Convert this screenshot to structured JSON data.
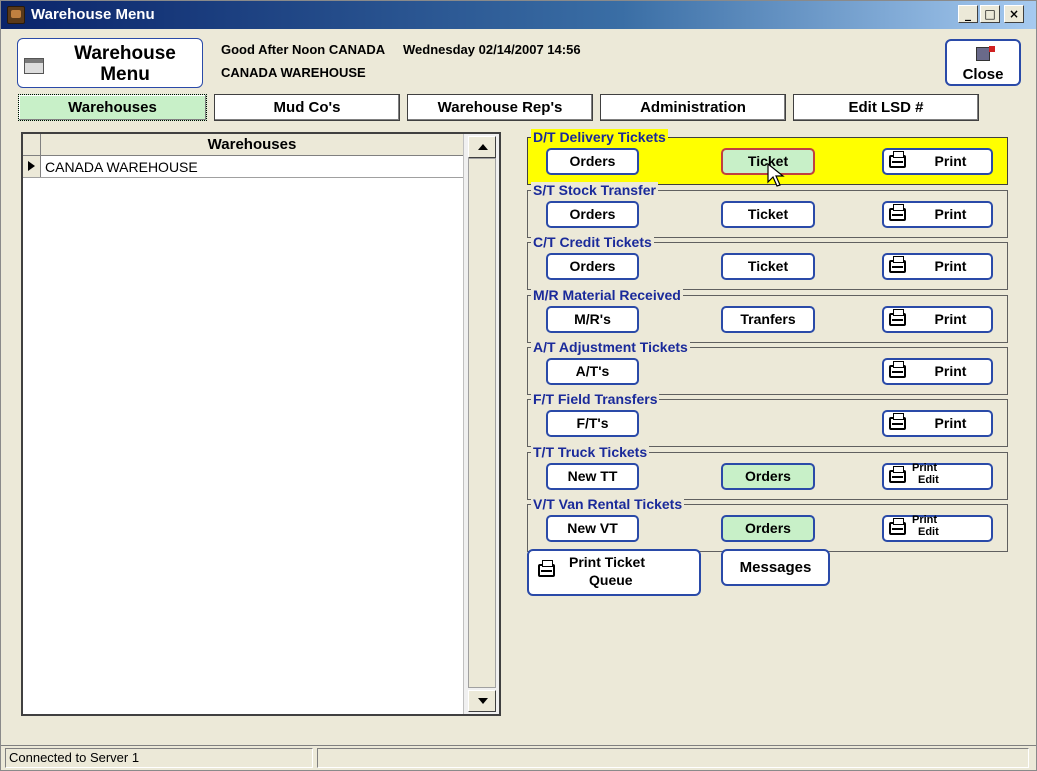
{
  "window": {
    "title": "Warehouse Menu",
    "minimize": "_",
    "maximize": "□",
    "close": "×"
  },
  "header": {
    "box_line1": "Warehouse",
    "box_line2": "Menu",
    "greeting": "Good After Noon CANADA",
    "warehouse": "CANADA WAREHOUSE",
    "datetime": "Wednesday 02/14/2007 14:56",
    "close_label": "Close"
  },
  "tabs": [
    {
      "label": "Warehouses",
      "active": true
    },
    {
      "label": "Mud Co's"
    },
    {
      "label": "Warehouse Rep's"
    },
    {
      "label": "Administration"
    },
    {
      "label": "Edit LSD #"
    }
  ],
  "grid": {
    "column": "Warehouses",
    "rows": [
      "CANADA WAREHOUSE"
    ]
  },
  "groups": [
    {
      "title": "D/T Delivery Tickets",
      "buttons": [
        "Orders",
        "Ticket",
        "Print"
      ]
    },
    {
      "title": "S/T Stock Transfer",
      "buttons": [
        "Orders",
        "Ticket",
        "Print"
      ]
    },
    {
      "title": "C/T Credit Tickets",
      "buttons": [
        "Orders",
        "Ticket",
        "Print"
      ]
    },
    {
      "title": "M/R Material Received",
      "buttons": [
        "M/R's",
        "Tranfers",
        "Print"
      ]
    },
    {
      "title": "A/T Adjustment Tickets",
      "buttons": [
        "A/T's",
        "",
        "Print"
      ]
    },
    {
      "title": "F/T Field Transfers",
      "buttons": [
        "F/T's",
        "",
        "Print"
      ]
    },
    {
      "title": "T/T Truck Tickets",
      "buttons": [
        "New TT",
        "Orders",
        "Print Edit"
      ]
    },
    {
      "title": "V/T Van Rental Tickets",
      "buttons": [
        "New VT",
        "Orders",
        "Print Edit"
      ]
    }
  ],
  "print_edit": {
    "line1": "Print",
    "line2": "Edit"
  },
  "bottom": {
    "print_queue_line1": "Print Ticket",
    "print_queue_line2": "Queue",
    "messages": "Messages"
  },
  "status": {
    "text": "Connected to Server 1"
  },
  "colors": {
    "title_bar": "#0a246a",
    "highlight_group": "#ffff00",
    "button_border": "#2a4aa8",
    "active_green": "#c8f0c8",
    "group_title": "#1a2a9a"
  }
}
